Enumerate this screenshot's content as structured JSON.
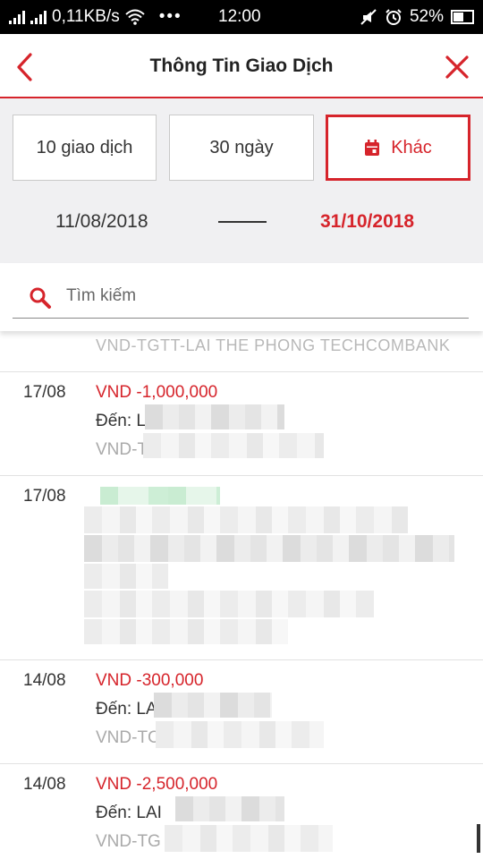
{
  "status_bar": {
    "network": "0,11KB/s",
    "time": "12:00",
    "battery": "52%"
  },
  "header": {
    "title": "Thông Tin Giao Dịch",
    "back_icon": "chevron-left-icon",
    "close_icon": "close-icon"
  },
  "filters": {
    "options": [
      "10 giao dịch",
      "30 ngày",
      "Khác"
    ],
    "selected": "Khác",
    "date_from": "11/08/2018",
    "date_to": "31/10/2018"
  },
  "search": {
    "placeholder": "Tìm kiếm"
  },
  "transactions": {
    "cut_off_text": "VND-TGTT-LAI THE PHONG TECHCOMBANK",
    "items": [
      {
        "date": "17/08",
        "amount": "VND -1,000,000",
        "to": "Đến: L",
        "account": "VND-T"
      },
      {
        "date": "17/08",
        "amount": "",
        "to": "",
        "account": ""
      },
      {
        "date": "14/08",
        "amount": "VND -300,000",
        "to": "Đến: LA",
        "account": "VND-TC"
      },
      {
        "date": "14/08",
        "amount": "VND -2,500,000",
        "to": "Đến: LAI",
        "account": "VND-TG"
      }
    ]
  },
  "colors": {
    "accent": "#d6242b",
    "filter_bg": "#f0f0f2",
    "muted_text": "#aaaaaa"
  }
}
